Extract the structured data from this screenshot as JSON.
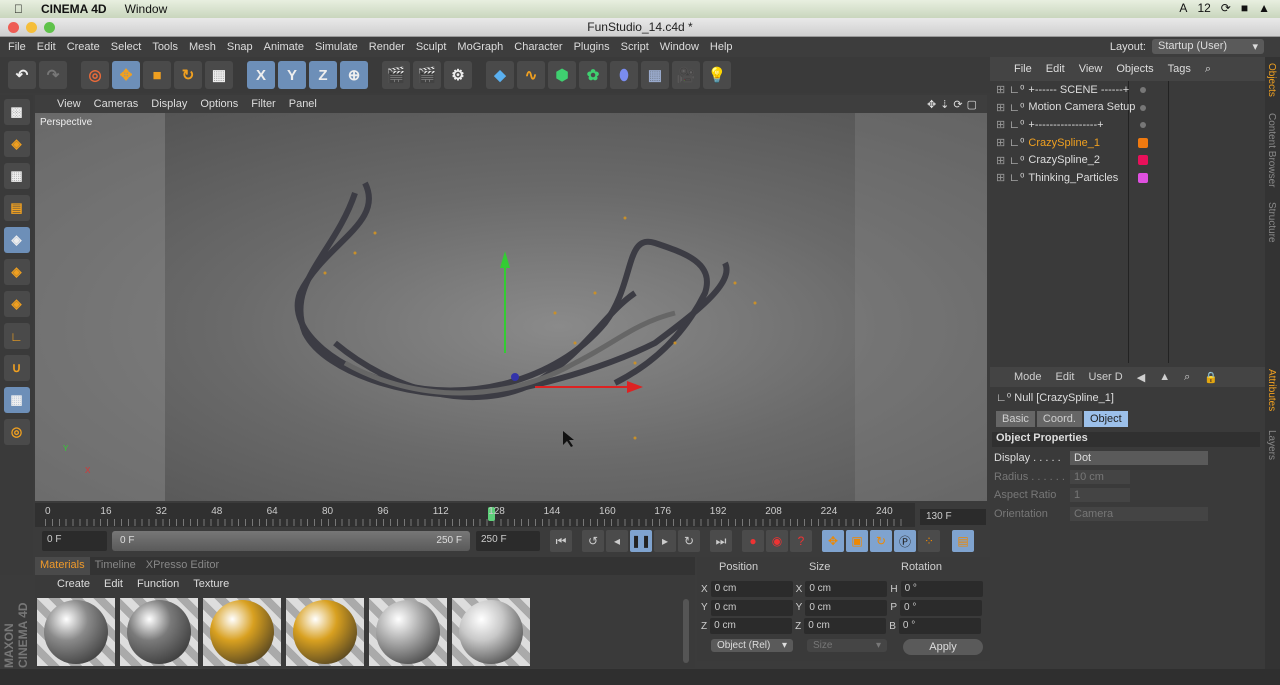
{
  "mac_menubar": {
    "app": "CINEMA 4D",
    "menu": "Window",
    "right_text": "12"
  },
  "window": {
    "title": "FunStudio_14.c4d *"
  },
  "menubar": {
    "items": [
      "File",
      "Edit",
      "Create",
      "Select",
      "Tools",
      "Mesh",
      "Snap",
      "Animate",
      "Simulate",
      "Render",
      "Sculpt",
      "MoGraph",
      "Character",
      "Plugins",
      "Script",
      "Window",
      "Help"
    ],
    "layout_label": "Layout:",
    "layout_value": "Startup (User)"
  },
  "toolbar": {
    "axis_x": "X",
    "axis_y": "Y",
    "axis_z": "Z"
  },
  "viewport": {
    "menu": [
      "View",
      "Cameras",
      "Display",
      "Options",
      "Filter",
      "Panel"
    ],
    "label": "Perspective"
  },
  "timeline": {
    "ticks": [
      "0",
      "16",
      "32",
      "48",
      "64",
      "80",
      "96",
      "112",
      "128",
      "144",
      "160",
      "176",
      "192",
      "208",
      "224",
      "240"
    ],
    "current_frame": "130 F",
    "playhead_frame": 128,
    "end": 250
  },
  "transport": {
    "start_field": "0 F",
    "range_start": "0 F",
    "range_end": "250 F",
    "end_field": "250 F"
  },
  "materials": {
    "tabs": [
      "Materials",
      "Timeline",
      "XPresso Editor"
    ],
    "menu": [
      "Create",
      "Edit",
      "Function",
      "Texture"
    ],
    "swatches": [
      {
        "color": "#8a8a8a"
      },
      {
        "color": "#7a7a7a"
      },
      {
        "color": "#d8a020"
      },
      {
        "color": "#d8a020"
      },
      {
        "color": "#b0b0b0"
      },
      {
        "color": "#c8c8c8"
      }
    ]
  },
  "coords": {
    "headers": [
      "Position",
      "Size",
      "Rotation"
    ],
    "rows": [
      {
        "a": "X",
        "p": "0 cm",
        "b": "X",
        "s": "0 cm",
        "c": "H",
        "r": "0 °"
      },
      {
        "a": "Y",
        "p": "0 cm",
        "b": "Y",
        "s": "0 cm",
        "c": "P",
        "r": "0 °"
      },
      {
        "a": "Z",
        "p": "0 cm",
        "b": "Z",
        "s": "0 cm",
        "c": "B",
        "r": "0 °"
      }
    ],
    "mode": "Object (Rel)",
    "size_mode": "Size",
    "apply": "Apply"
  },
  "objects": {
    "menu": [
      "File",
      "Edit",
      "View",
      "Objects",
      "Tags"
    ],
    "items": [
      {
        "name": "+------ SCENE ------+",
        "color": ""
      },
      {
        "name": "Motion Camera Setup",
        "color": ""
      },
      {
        "name": "+-----------------+",
        "color": ""
      },
      {
        "name": "CrazySpline_1",
        "color": "#f07a10"
      },
      {
        "name": "CrazySpline_2",
        "color": "#e8105a"
      },
      {
        "name": "Thinking_Particles",
        "color": "#e050e0"
      }
    ]
  },
  "attributes": {
    "menu": [
      "Mode",
      "Edit",
      "User D"
    ],
    "object_title": "Null [CrazySpline_1]",
    "tabs": [
      "Basic",
      "Coord.",
      "Object"
    ],
    "section": "Object Properties",
    "props": [
      {
        "label": "Display . . . . .",
        "value": "Dot"
      },
      {
        "label": "Radius . . . . . .",
        "value": "10 cm"
      },
      {
        "label": "Aspect Ratio",
        "value": "1"
      },
      {
        "label": "Orientation",
        "value": "Camera"
      }
    ]
  },
  "side_tabs": [
    "Objects",
    "Content Browser",
    "Structure",
    "Attributes",
    "Layers"
  ],
  "brand": "MAXON CINEMA 4D"
}
